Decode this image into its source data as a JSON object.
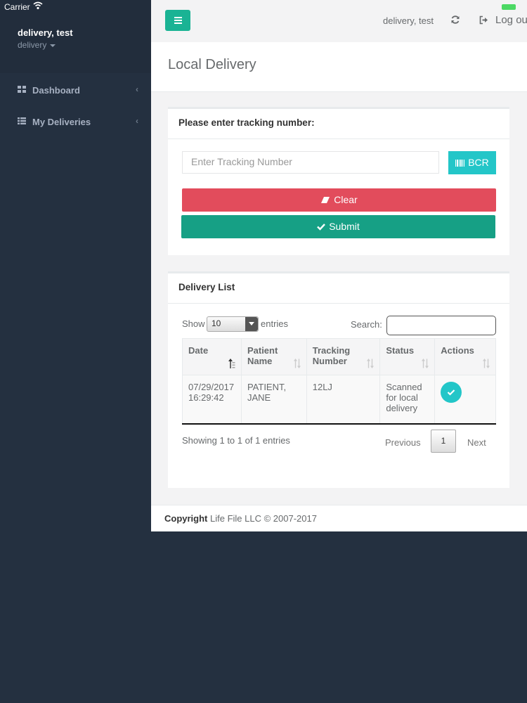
{
  "status_bar": {
    "carrier": "Carrier"
  },
  "sidebar": {
    "profile": {
      "name": "delivery, test",
      "role": "delivery"
    },
    "items": [
      {
        "label": "Dashboard",
        "icon": "dashboard-icon"
      },
      {
        "label": "My Deliveries",
        "icon": "list-icon"
      }
    ]
  },
  "topbar": {
    "user": "delivery, test",
    "logout_label": "Log out"
  },
  "page": {
    "title": "Local Delivery"
  },
  "tracking": {
    "title": "Please enter tracking number:",
    "placeholder": "Enter Tracking Number",
    "bcr_label": "BCR",
    "clear_label": "Clear",
    "submit_label": "Submit"
  },
  "delivery_list": {
    "title": "Delivery List",
    "show_label": "Show",
    "entries_value": "10",
    "entries_label": "entries",
    "search_label": "Search:",
    "columns": [
      "Date",
      "Patient Name",
      "Tracking Number",
      "Status",
      "Actions"
    ],
    "rows": [
      {
        "date": "07/29/2017 16:29:42",
        "patient": "PATIENT, JANE",
        "tracking": "12LJ",
        "status": "Scanned for local delivery"
      }
    ],
    "info": "Showing 1 to 1 of 1 entries",
    "previous_label": "Previous",
    "page_number": "1",
    "next_label": "Next"
  },
  "footer": {
    "copyright_label": "Copyright",
    "company": "Life File LLC © 2007-2017"
  },
  "colors": {
    "primary": "#1ab394",
    "info": "#23c6c8",
    "danger": "#e24c5c",
    "success": "#16a085",
    "sidebar": "#243040"
  }
}
